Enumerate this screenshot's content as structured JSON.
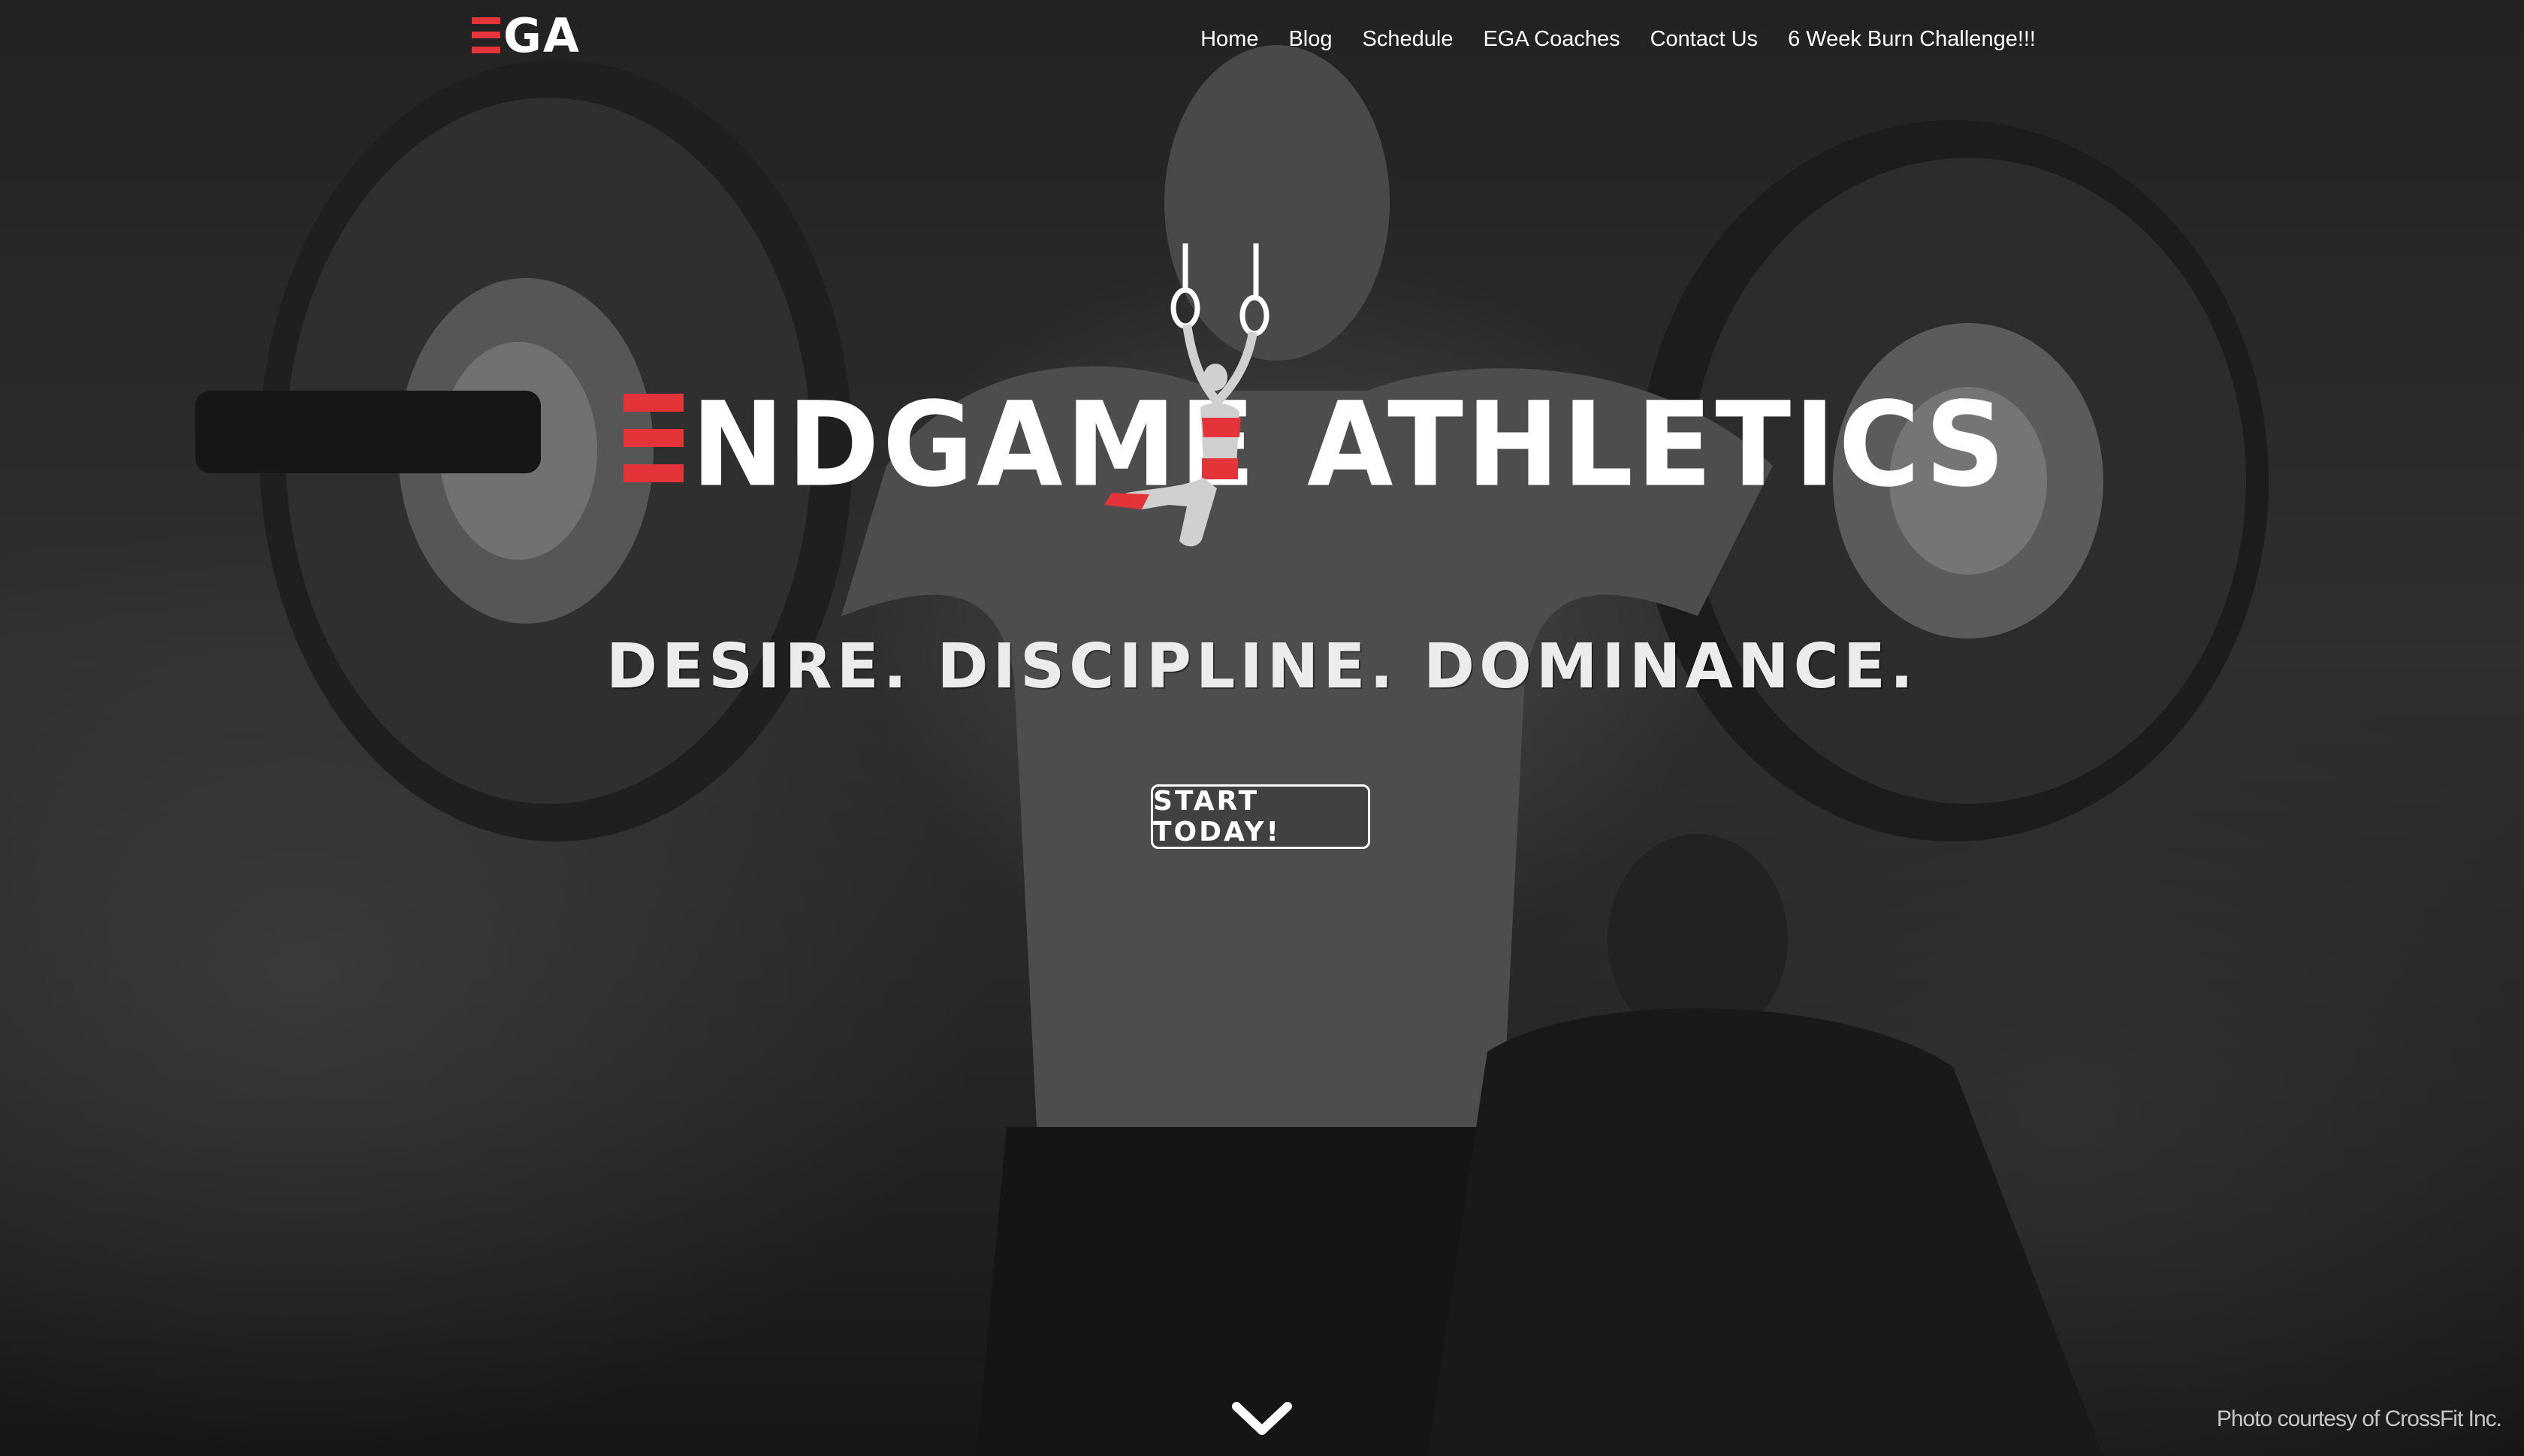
{
  "header": {
    "logo_text": "GA",
    "nav": [
      {
        "label": "Home"
      },
      {
        "label": "Blog"
      },
      {
        "label": "Schedule"
      },
      {
        "label": "EGA Coaches"
      },
      {
        "label": "Contact Us"
      },
      {
        "label": "6 Week Burn Challenge!!!"
      }
    ]
  },
  "hero": {
    "brand_word_1": "NDGAME",
    "brand_word_2": "ATHLETICS",
    "tagline": "DESIRE.  DISCIPLINE.  DOMINANCE.",
    "cta_label": "START TODAY!",
    "photo_credit": "Photo courtesy of CrossFit Inc."
  },
  "colors": {
    "accent": "#e5333a",
    "text": "#ffffff"
  },
  "icons": {
    "scroll": "chevron-down-icon",
    "brand_figure": "gymnast-rings-icon"
  }
}
